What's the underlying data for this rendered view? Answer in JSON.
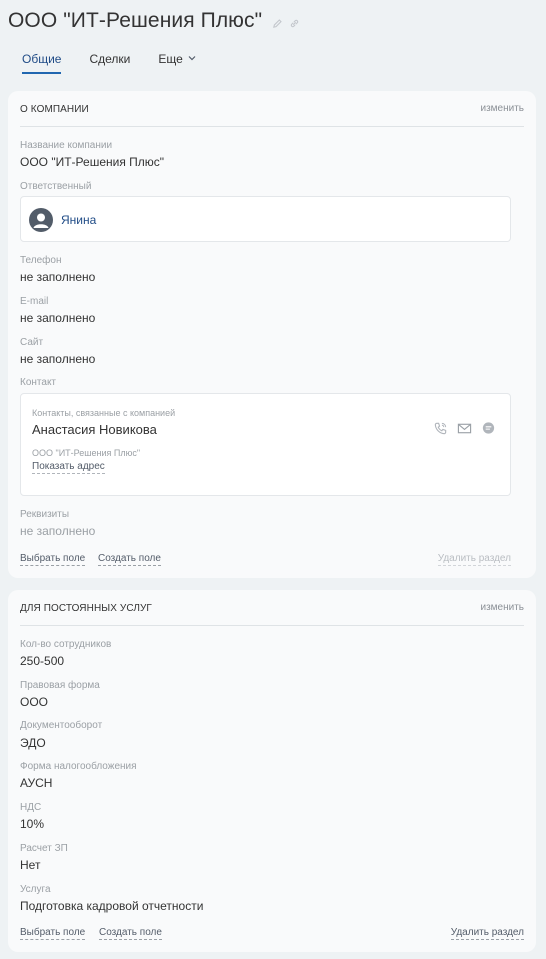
{
  "header": {
    "title": "ООО \"ИТ-Решения Плюс\"",
    "edit_icon": "pencil-icon",
    "link_icon": "link-icon"
  },
  "tabs": [
    {
      "label": "Общие",
      "active": true
    },
    {
      "label": "Сделки",
      "active": false
    },
    {
      "label": "Еще",
      "active": false
    }
  ],
  "about": {
    "title": "О КОМПАНИИ",
    "edit": "изменить",
    "company_name_label": "Название компании",
    "company_name": "ООО \"ИТ-Решения Плюс\"",
    "responsible_label": "Ответственный",
    "responsible_name": "Янина",
    "phone_label": "Телефон",
    "phone_value": "не заполнено",
    "email_label": "E-mail",
    "email_value": "не заполнено",
    "site_label": "Сайт",
    "site_value": "не заполнено",
    "contact_label": "Контакт",
    "contact": {
      "caption": "Контакты, связанные с компанией",
      "name": "Анастасия Новикова",
      "company": "ООО \"ИТ-Решения Плюс\"",
      "address_link": "Показать адрес",
      "icons": [
        "phone-icon",
        "mail-icon",
        "chat-icon"
      ]
    },
    "requisites_label": "Реквизиты",
    "requisites_value": "не заполнено",
    "select_field": "Выбрать поле",
    "create_field": "Создать поле",
    "delete_section": "Удалить раздел"
  },
  "services": {
    "title": "ДЛЯ ПОСТОЯННЫХ УСЛУГ",
    "edit": "изменить",
    "fields": [
      {
        "label": "Кол-во сотрудников",
        "value": "250-500"
      },
      {
        "label": "Правовая форма",
        "value": "ООО"
      },
      {
        "label": "Документооборот",
        "value": "ЭДО"
      },
      {
        "label": "Форма налогообложения",
        "value": "АУСН"
      },
      {
        "label": "НДС",
        "value": "10%"
      },
      {
        "label": "Расчет ЗП",
        "value": "Нет"
      },
      {
        "label": "Услуга",
        "value": "Подготовка кадровой отчетности"
      }
    ],
    "select_field": "Выбрать поле",
    "create_field": "Создать поле",
    "delete_section": "Удалить раздел"
  },
  "colors": {
    "accent": "#2067b0",
    "link": "#1f4b86",
    "background": "#eef2f4",
    "card": "#f9fafb"
  }
}
